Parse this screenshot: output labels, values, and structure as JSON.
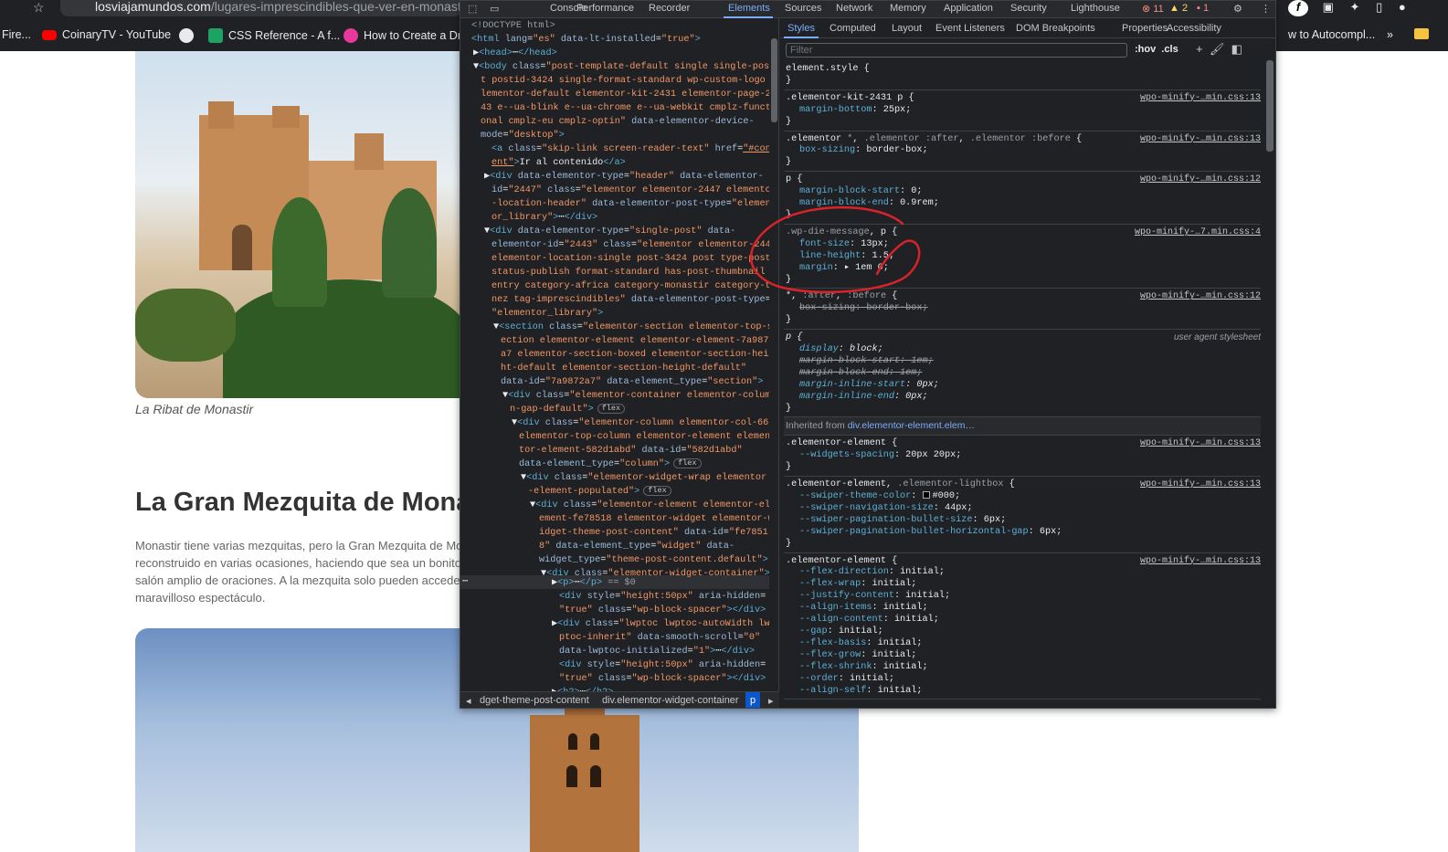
{
  "browser": {
    "url_host": "losviajamundos.com",
    "url_path": "/lugares-imprescindibles-que-ver-en-monast",
    "bookmarks": [
      "Fire...",
      "CoinaryTV - YouTube",
      "CSS Reference - A f...",
      "How to Create a Dr...",
      "w to Autocompl..."
    ]
  },
  "page": {
    "caption1": "La Ribat de Monastir",
    "heading": "La Gran Mezquita de Mona",
    "paragraph": [
      "Monastir tiene varias mezquitas, pero la Gran Mezquita de Mo",
      "reconstruido en varias ocasiones, haciendo que sea un bonito",
      "salón amplio de oraciones. A la mezquita solo pueden acceder",
      "maravilloso espectáculo."
    ]
  },
  "devtools": {
    "tabs": [
      "Console",
      "Performance",
      "Recorder",
      "Elements",
      "Sources",
      "Network",
      "Memory",
      "Application",
      "Security",
      "Lighthouse"
    ],
    "active_tab": "Elements",
    "errors": "11",
    "warnings": "2",
    "issues": "1",
    "breadcrumbs": [
      "dget-theme-post-content",
      "div.elementor-widget-container",
      "p"
    ],
    "styles_tabs": [
      "Styles",
      "Computed",
      "Layout",
      "Event Listeners",
      "DOM Breakpoints",
      "Properties",
      "Accessibility"
    ],
    "filter_placeholder": "Filter",
    "hov": ":hov",
    "cls": ".cls",
    "inherited_label": "Inherited from",
    "inherited_from": "div.elementor-element.elem…"
  },
  "annotation_color": "#d8232a"
}
